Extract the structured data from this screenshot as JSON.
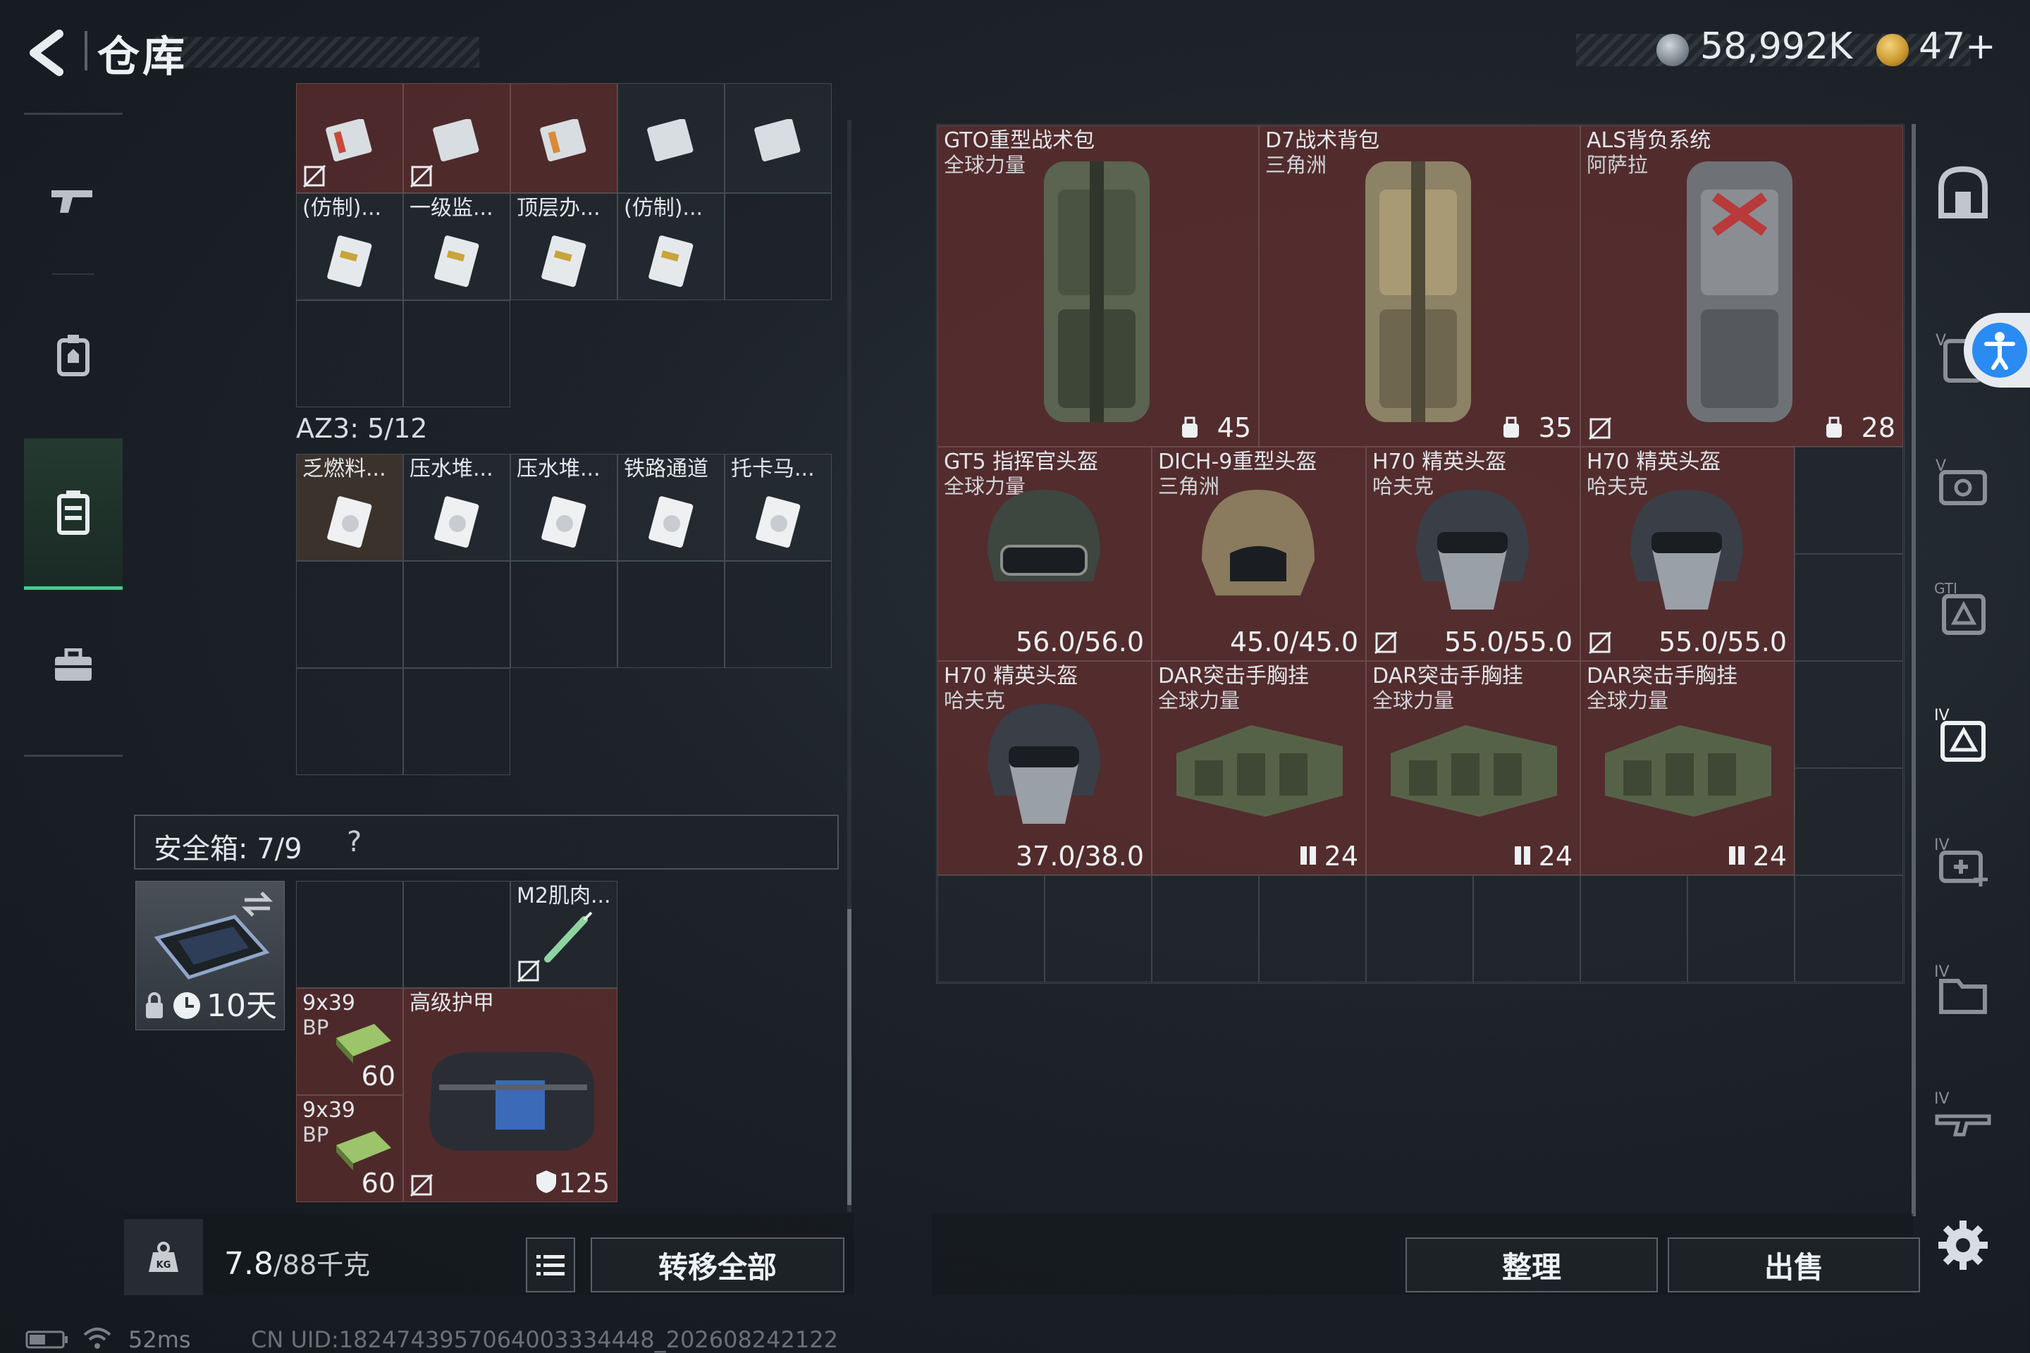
{
  "header": {
    "title": "仓库",
    "currency1": "58,992K",
    "currency2": "47+"
  },
  "left_panel": {
    "top_row": [
      {
        "label": ""
      },
      {
        "label": ""
      },
      {
        "label": ""
      },
      {
        "label": ""
      },
      {
        "label": ""
      }
    ],
    "row2": [
      {
        "label": "(仿制)..."
      },
      {
        "label": "一级监..."
      },
      {
        "label": "顶层办..."
      },
      {
        "label": "(仿制)..."
      }
    ],
    "az3_label": "AZ3: 5/12",
    "az3_items": [
      {
        "label": "乏燃料..."
      },
      {
        "label": "压水堆..."
      },
      {
        "label": "压水堆..."
      },
      {
        "label": "铁路通道"
      },
      {
        "label": "托卡马..."
      }
    ],
    "safebox_label": "安全箱: 7/9",
    "safebox_help": "?",
    "safebox_timer": "10天",
    "safe_items": {
      "m2": "M2肌肉...",
      "ammo1_name": "9x39",
      "ammo1_sub": "BP",
      "ammo1_count": "60",
      "ammo2_name": "9x39",
      "ammo2_sub": "BP",
      "ammo2_count": "60",
      "armor_name": "高级护甲",
      "armor_value": "125"
    }
  },
  "footer_left": {
    "weight": "7.8",
    "weight_max": "/88千克",
    "transfer_all": "转移全部"
  },
  "right_panel": {
    "backpacks": [
      {
        "name": "GTO重型战术包",
        "sub": "全球力量",
        "value": "45"
      },
      {
        "name": "D7战术背包",
        "sub": "三角洲",
        "value": "35"
      },
      {
        "name": "ALS背负系统",
        "sub": "阿萨拉",
        "value": "28"
      }
    ],
    "helmets": [
      {
        "name": "GT5 指挥官头盔",
        "sub": "全球力量",
        "value": "56.0/56.0"
      },
      {
        "name": "DICH-9重型头盔",
        "sub": "三角洲",
        "value": "45.0/45.0"
      },
      {
        "name": "H70 精英头盔",
        "sub": "哈夫克",
        "value": "55.0/55.0"
      },
      {
        "name": "H70 精英头盔",
        "sub": "哈夫克",
        "value": "55.0/55.0"
      }
    ],
    "row3": [
      {
        "name": "H70 精英头盔",
        "sub": "哈夫克",
        "value": "37.0/38.0"
      },
      {
        "name": "DAR突击手胸挂",
        "sub": "全球力量",
        "value": "24"
      },
      {
        "name": "DAR突击手胸挂",
        "sub": "全球力量",
        "value": "24"
      },
      {
        "name": "DAR突击手胸挂",
        "sub": "全球力量",
        "value": "24"
      }
    ],
    "sort_button": "整理",
    "sell_button": "出售"
  },
  "status_bar": {
    "ping": "52ms",
    "uid": "CN UID:1824743957064003334448_202608242122"
  },
  "colors": {
    "accent_green": "#47c98c",
    "item_red": "#602e2e",
    "accessibility_blue": "#2a8bf2"
  }
}
